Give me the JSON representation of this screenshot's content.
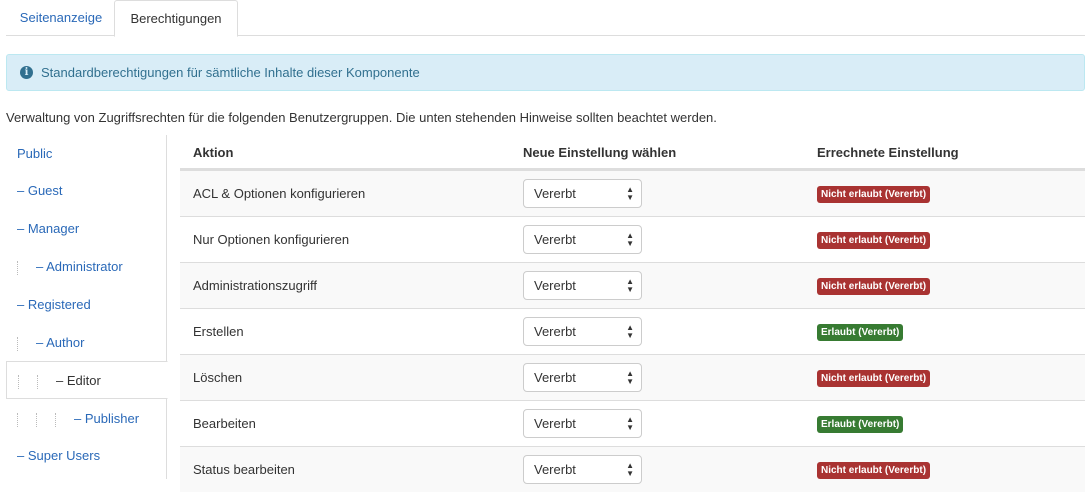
{
  "tabs": [
    "Seitenanzeige",
    "Berechtigungen"
  ],
  "alert": {
    "icon": "info-icon",
    "text": "Standardberechtigungen für sämtliche Inhalte dieser Komponente"
  },
  "description": "Verwaltung von Zugriffsrechten für die folgenden Benutzergruppen. Die unten stehenden Hinweise sollten beachtet werden.",
  "groups": [
    {
      "label": "Public",
      "level": 0
    },
    {
      "label": "– Guest",
      "level": 0
    },
    {
      "label": "– Manager",
      "level": 0
    },
    {
      "label": "– Administrator",
      "level": 1
    },
    {
      "label": "– Registered",
      "level": 0
    },
    {
      "label": "– Author",
      "level": 1
    },
    {
      "label": "– Editor",
      "level": 2,
      "active": true
    },
    {
      "label": "– Publisher",
      "level": 3
    },
    {
      "label": "– Super Users",
      "level": 0
    }
  ],
  "table": {
    "headers": {
      "action": "Aktion",
      "setting": "Neue Einstellung wählen",
      "calculated": "Errechnete Einstellung"
    },
    "rows": [
      {
        "action": "ACL & Optionen konfigurieren",
        "setting": "Vererbt",
        "calculated": "Nicht erlaubt (Vererbt)",
        "status": "denied"
      },
      {
        "action": "Nur Optionen konfigurieren",
        "setting": "Vererbt",
        "calculated": "Nicht erlaubt (Vererbt)",
        "status": "denied"
      },
      {
        "action": "Administrationszugriff",
        "setting": "Vererbt",
        "calculated": "Nicht erlaubt (Vererbt)",
        "status": "denied"
      },
      {
        "action": "Erstellen",
        "setting": "Vererbt",
        "calculated": "Erlaubt (Vererbt)",
        "status": "allowed"
      },
      {
        "action": "Löschen",
        "setting": "Vererbt",
        "calculated": "Nicht erlaubt (Vererbt)",
        "status": "denied"
      },
      {
        "action": "Bearbeiten",
        "setting": "Vererbt",
        "calculated": "Erlaubt (Vererbt)",
        "status": "allowed"
      },
      {
        "action": "Status bearbeiten",
        "setting": "Vererbt",
        "calculated": "Nicht erlaubt (Vererbt)",
        "status": "denied"
      }
    ]
  },
  "colors": {
    "link": "#2a69b8",
    "denied": "#a93332",
    "allowed": "#377b32",
    "alert_bg": "#d9edf7"
  }
}
